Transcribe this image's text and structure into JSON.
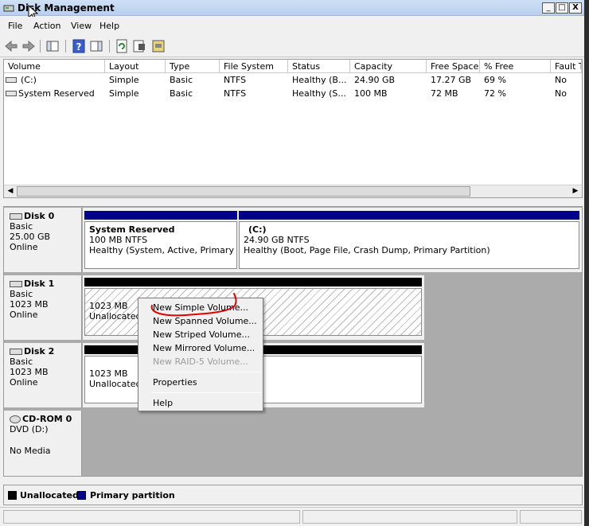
{
  "window": {
    "title": "Disk Management",
    "min_glyph": "_",
    "max_glyph": "□",
    "close_glyph": "X"
  },
  "menu": [
    "File",
    "Action",
    "View",
    "Help"
  ],
  "toolbar_icons": [
    "back-arrow-icon",
    "forward-arrow-icon",
    "show-hide-console-tree-icon",
    "help-icon",
    "show-action-pane-icon",
    "refresh-icon",
    "properties-icon",
    "disk-settings-icon"
  ],
  "volume_table": {
    "columns": [
      "Volume",
      "Layout",
      "Type",
      "File System",
      "Status",
      "Capacity",
      "Free Space",
      "% Free",
      "Fault T"
    ],
    "rows": [
      [
        "(C:)",
        "Simple",
        "Basic",
        "NTFS",
        "Healthy (B...",
        "24.90 GB",
        "17.27 GB",
        "69 %",
        "No"
      ],
      [
        "System Reserved",
        "Simple",
        "Basic",
        "NTFS",
        "Healthy (S...",
        "100 MB",
        "72 MB",
        "72 %",
        "No"
      ]
    ]
  },
  "disks": {
    "disk0": {
      "name": "Disk 0",
      "type": "Basic",
      "size": "25.00 GB",
      "status": "Online",
      "part1": {
        "name": "System Reserved",
        "size": "100 MB NTFS",
        "status": "Healthy (System, Active, Primary Partition)"
      },
      "part2": {
        "name": "(C:)",
        "size": "24.90 GB NTFS",
        "status": "Healthy (Boot, Page File, Crash Dump, Primary Partition)"
      }
    },
    "disk1": {
      "name": "Disk 1",
      "type": "Basic",
      "size": "1023 MB",
      "status": "Online",
      "part": {
        "size": "1023 MB",
        "status": "Unallocated"
      }
    },
    "disk2": {
      "name": "Disk 2",
      "type": "Basic",
      "size": "1023 MB",
      "status": "Online",
      "part": {
        "size": "1023 MB",
        "status": "Unallocated"
      }
    },
    "cdrom0": {
      "name": "CD-ROM 0",
      "type": "DVD (D:)",
      "status": "No Media"
    }
  },
  "legend": {
    "unallocated": "Unallocated",
    "primary": "Primary partition"
  },
  "context_menu": {
    "items": [
      "New Simple Volume...",
      "New Spanned Volume...",
      "New Striped Volume...",
      "New Mirrored Volume...",
      "New RAID-5 Volume..."
    ],
    "properties": "Properties",
    "help": "Help"
  },
  "colors": {
    "primary_partition": "#00008b",
    "unallocated": "#000000",
    "annotation": "#e00000"
  }
}
